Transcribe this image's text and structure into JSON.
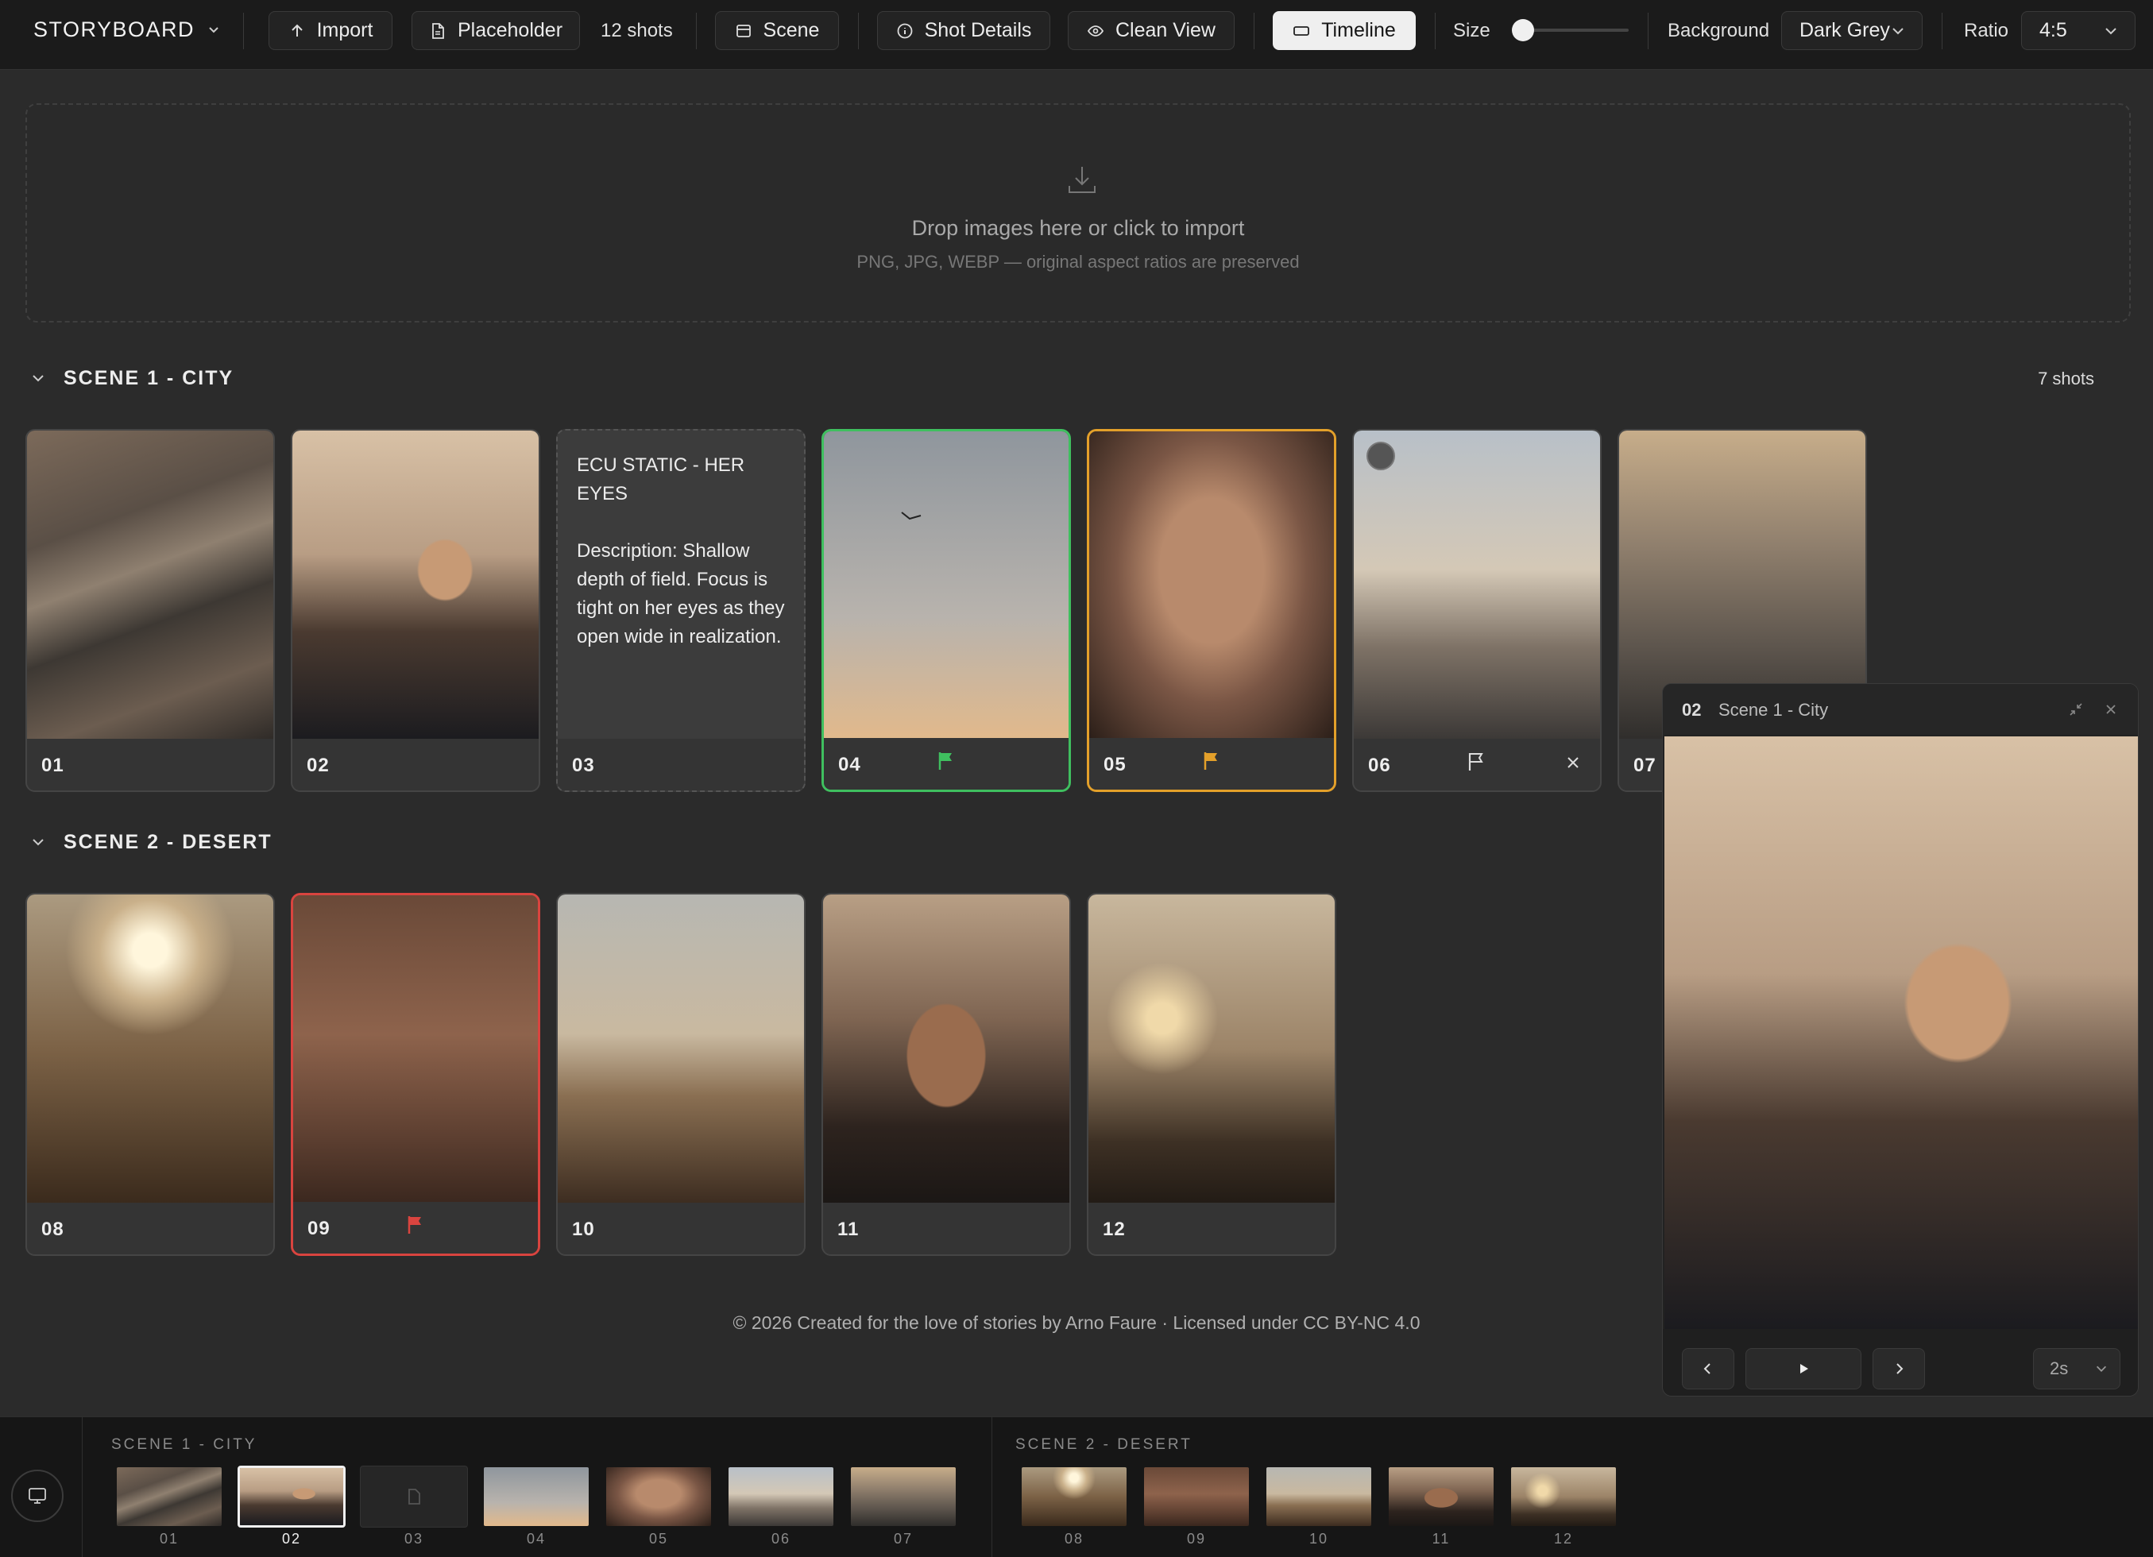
{
  "app": {
    "title": "STORYBOARD"
  },
  "toolbar": {
    "import_label": "Import",
    "placeholder_label": "Placeholder",
    "shots_count": "12 shots",
    "scene_label": "Scene",
    "shot_details_label": "Shot Details",
    "clean_view_label": "Clean View",
    "timeline_label": "Timeline",
    "size_label": "Size",
    "size_value": 0.05,
    "background_label": "Background",
    "background_value": "Dark Grey",
    "ratio_label": "Ratio",
    "ratio_value": "4:5"
  },
  "dropzone": {
    "main_text": "Drop images here or click to import",
    "sub_text": "PNG, JPG, WEBP — original aspect ratios are preserved"
  },
  "scenes": [
    {
      "title": "SCENE 1 - CITY",
      "count": "7 shots",
      "shots": [
        {
          "num": "01"
        },
        {
          "num": "02"
        },
        {
          "num": "03",
          "placeholder_title": "ECU  STATIC - HER EYES",
          "placeholder_desc": "Description: Shallow depth of field. Focus is tight on her eyes as they open wide in realization."
        },
        {
          "num": "04",
          "flag": "green"
        },
        {
          "num": "05",
          "flag": "orange"
        },
        {
          "num": "06",
          "flag": "outline"
        },
        {
          "num": "07"
        }
      ]
    },
    {
      "title": "SCENE 2 - DESERT",
      "shots": [
        {
          "num": "08"
        },
        {
          "num": "09",
          "flag": "red"
        },
        {
          "num": "10"
        },
        {
          "num": "11"
        },
        {
          "num": "12"
        }
      ]
    }
  ],
  "credit": "© 2026 Created for the love of stories by Arno Faure · Licensed under CC BY-NC 4.0",
  "preview": {
    "shot_num": "02",
    "scene_title": "Scene 1 - City",
    "duration": "2s"
  },
  "timeline": {
    "scene1_label": "SCENE 1 - CITY",
    "scene2_label": "SCENE 2 - DESERT",
    "thumbs": [
      "01",
      "02",
      "03",
      "04",
      "05",
      "06",
      "07",
      "08",
      "09",
      "10",
      "11",
      "12"
    ],
    "selected": "02"
  },
  "colors": {
    "accent_green": "#3fbf5f",
    "accent_orange": "#e3a02a",
    "accent_red": "#d9443f",
    "background": "#2b2b2b"
  }
}
